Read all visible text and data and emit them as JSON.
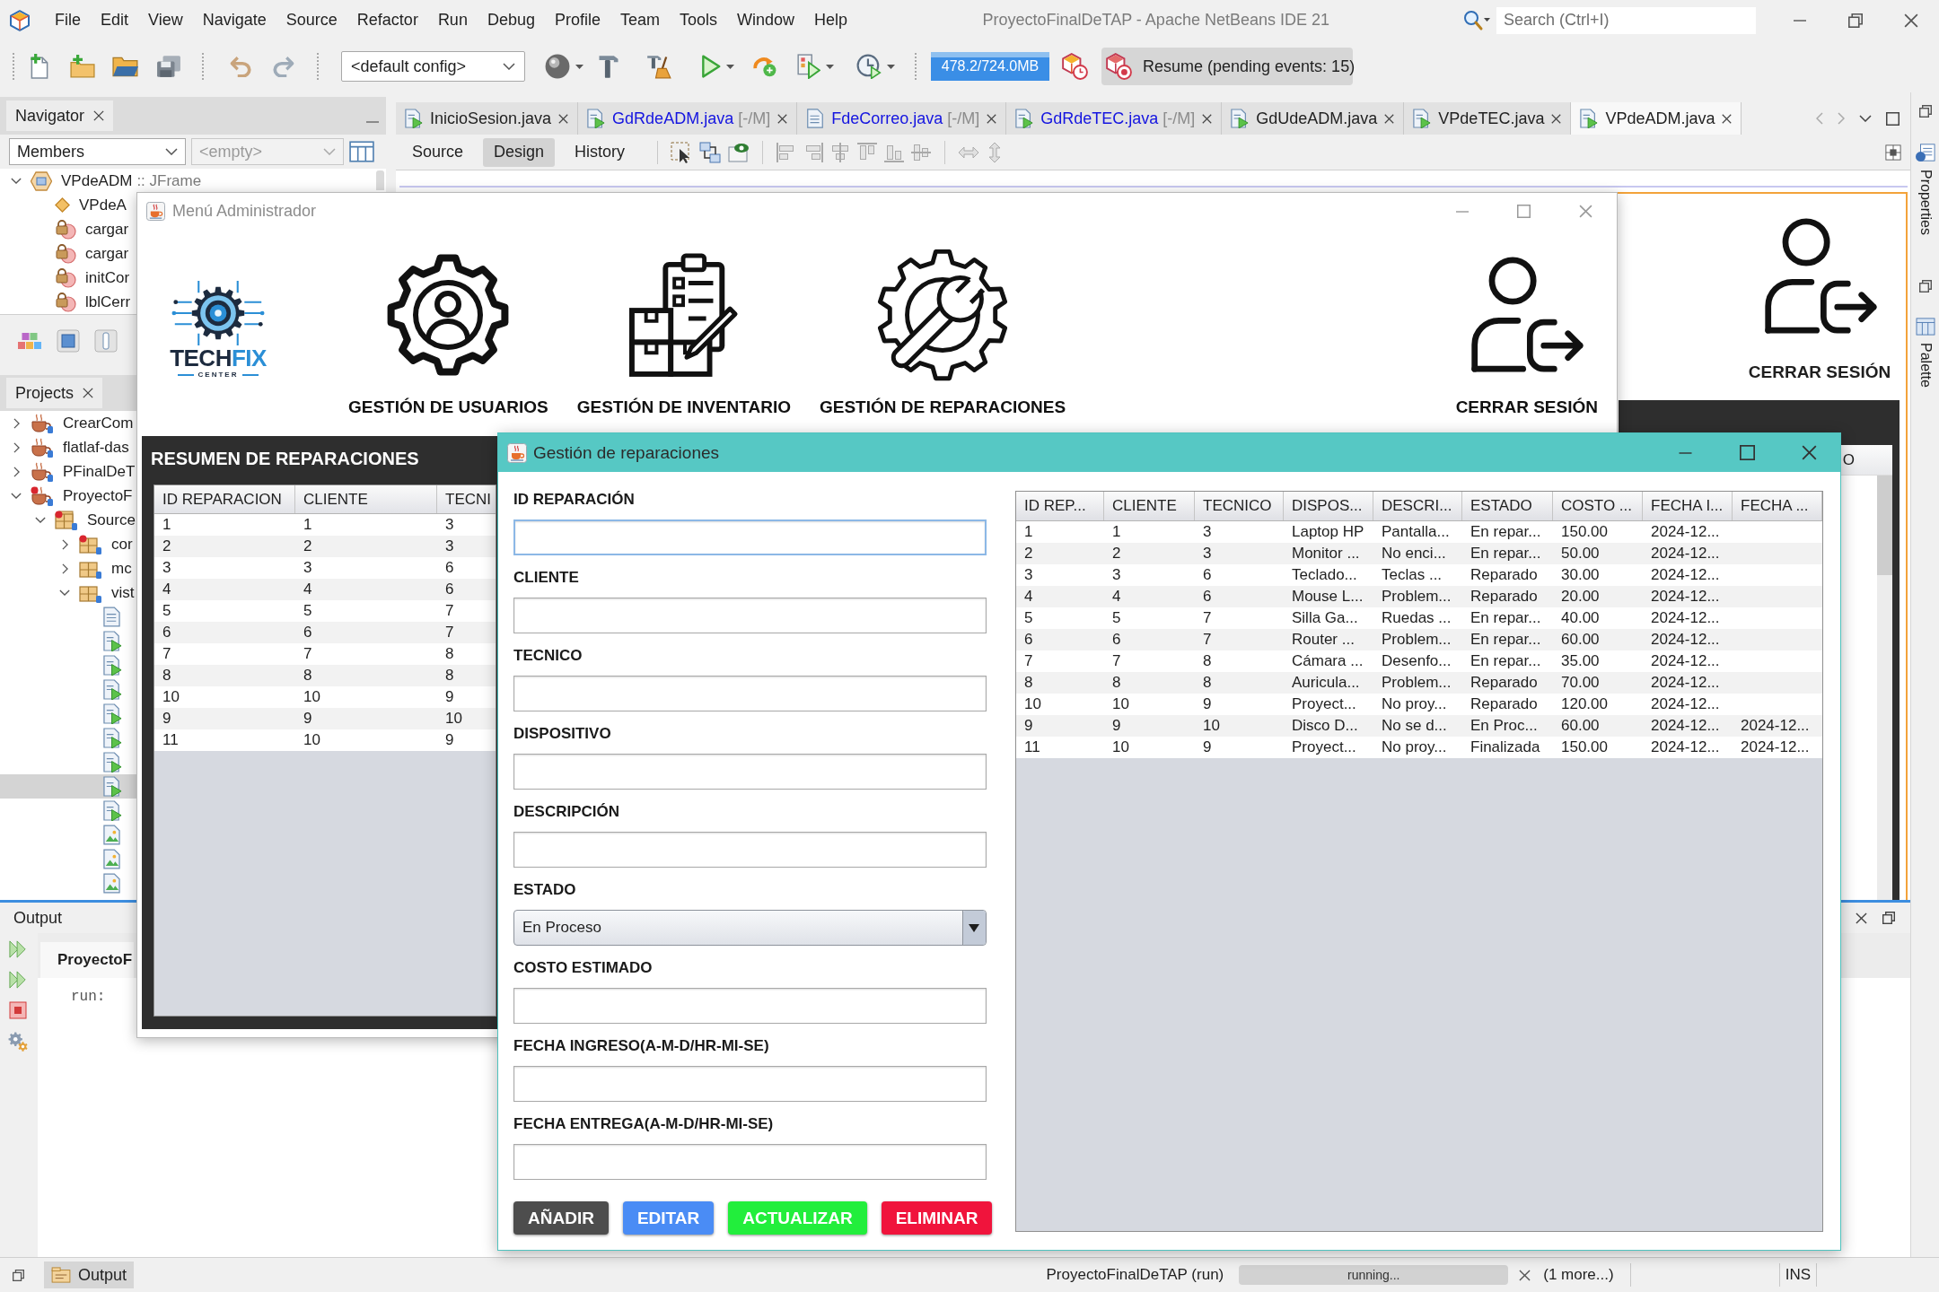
{
  "ide": {
    "title": "ProyectoFinalDeTAP - Apache NetBeans IDE 21",
    "menu": [
      "File",
      "Edit",
      "View",
      "Navigate",
      "Source",
      "Refactor",
      "Run",
      "Debug",
      "Profile",
      "Team",
      "Tools",
      "Window",
      "Help"
    ],
    "search": {
      "placeholder": "Search (Ctrl+I)"
    },
    "toolbar": {
      "config": "<default config>",
      "memory": "478.2/724.0MB",
      "resume": "Resume (pending events: 15)"
    },
    "navigator": {
      "title": "Navigator",
      "filter": "Members",
      "scope": "<empty>",
      "tree": [
        {
          "label": "VPdeADM",
          "detail": ":: JFrame",
          "kind": "frame",
          "expanded": true,
          "children": [
            {
              "label": "VPdeA",
              "kind": "constructor"
            },
            {
              "label": "cargar",
              "kind": "method"
            },
            {
              "label": "cargar",
              "kind": "method"
            },
            {
              "label": "initCor",
              "kind": "method"
            },
            {
              "label": "lblCerr",
              "kind": "method"
            }
          ]
        }
      ]
    },
    "projects": {
      "title": "Projects",
      "tree": [
        {
          "label": "CrearCom",
          "kind": "project",
          "expanded": false,
          "selected": false
        },
        {
          "label": "flatlaf-das",
          "kind": "project",
          "expanded": false,
          "selected": false
        },
        {
          "label": "PFinalDeT",
          "kind": "project",
          "expanded": false,
          "selected": false
        },
        {
          "label": "ProyectoF",
          "kind": "project-error",
          "expanded": true,
          "selected": false,
          "children": [
            {
              "label": "Source",
              "kind": "sources",
              "expanded": true,
              "selected": false,
              "children": [
                {
                  "label": "cor",
                  "kind": "package-error",
                  "expanded": false,
                  "selected": false
                },
                {
                  "label": "mc",
                  "kind": "package",
                  "expanded": false,
                  "selected": false
                },
                {
                  "label": "vist",
                  "kind": "package",
                  "expanded": true,
                  "selected": false,
                  "children": [
                    {
                      "kind": "file",
                      "selected": false
                    },
                    {
                      "kind": "form",
                      "selected": false
                    },
                    {
                      "kind": "form",
                      "selected": false
                    },
                    {
                      "kind": "form",
                      "selected": false
                    },
                    {
                      "kind": "form",
                      "selected": false
                    },
                    {
                      "kind": "form",
                      "selected": false
                    },
                    {
                      "kind": "form",
                      "selected": false
                    },
                    {
                      "kind": "form",
                      "selected": true
                    },
                    {
                      "kind": "form",
                      "selected": false
                    },
                    {
                      "kind": "image",
                      "selected": false
                    },
                    {
                      "kind": "image",
                      "selected": false
                    },
                    {
                      "kind": "image",
                      "selected": false
                    }
                  ]
                }
              ]
            }
          ]
        }
      ]
    },
    "editor_tabs": [
      {
        "label": "InicioSesion.java",
        "kind": "form",
        "modified": false,
        "selected": false
      },
      {
        "label": "GdRdeADM.java",
        "suffix": "[-/M]",
        "kind": "form",
        "modified": true,
        "selected": false
      },
      {
        "label": "FdeCorreo.java",
        "suffix": "[-/M]",
        "kind": "class",
        "modified": true,
        "selected": false
      },
      {
        "label": "GdRdeTEC.java",
        "suffix": "[-/M]",
        "kind": "form",
        "modified": true,
        "selected": false
      },
      {
        "label": "GdUdeADM.java",
        "kind": "form",
        "modified": false,
        "selected": false
      },
      {
        "label": "VPdeTEC.java",
        "kind": "form",
        "modified": false,
        "selected": false
      },
      {
        "label": "VPdeADM.java",
        "kind": "form",
        "modified": false,
        "selected": true
      }
    ],
    "design_views": [
      {
        "label": "Source",
        "selected": false
      },
      {
        "label": "Design",
        "selected": true
      },
      {
        "label": "History",
        "selected": false
      }
    ],
    "design_form": {
      "logout_label": "CERRAR SESIÓN",
      "table_header": "O"
    },
    "side_panels": [
      {
        "label": "Properties",
        "kind": "properties"
      },
      {
        "label": "Palette",
        "kind": "palette"
      }
    ],
    "output": {
      "title": "Output",
      "tab": "ProyectoF",
      "text": "run:"
    },
    "status_bar": {
      "output_button": "Output",
      "task": "ProyectoFinalDeTAP (run)",
      "progress": "running...",
      "more": "(1 more...)",
      "mode": "INS"
    }
  },
  "menu_window": {
    "title": "Menú Administrador",
    "logo": {
      "name_1": "TECH",
      "name_2": "FIX",
      "tagline": "CENTER"
    },
    "nav": [
      {
        "label": "GESTIÓN DE USUARIOS",
        "kind": "users"
      },
      {
        "label": "GESTIÓN DE INVENTARIO",
        "kind": "inventory"
      },
      {
        "label": "GESTIÓN DE REPARACIONES",
        "kind": "repairs"
      },
      {
        "label": "CERRAR SESIÓN",
        "kind": "logout"
      }
    ],
    "summary": {
      "title": "RESUMEN DE REPARACIONES",
      "columns": [
        "ID REPARACION",
        "CLIENTE",
        "TECNI"
      ],
      "rows": [
        [
          "1",
          "1",
          "3"
        ],
        [
          "2",
          "2",
          "3"
        ],
        [
          "3",
          "3",
          "6"
        ],
        [
          "4",
          "4",
          "6"
        ],
        [
          "5",
          "5",
          "7"
        ],
        [
          "6",
          "6",
          "7"
        ],
        [
          "7",
          "7",
          "8"
        ],
        [
          "8",
          "8",
          "8"
        ],
        [
          "10",
          "10",
          "9"
        ],
        [
          "9",
          "9",
          "10"
        ],
        [
          "11",
          "10",
          "9"
        ]
      ]
    }
  },
  "repairs_window": {
    "title": "Gestión de reparaciones",
    "fields": [
      {
        "label": "ID REPARACIÓN",
        "kind": "text",
        "focused": true
      },
      {
        "label": "CLIENTE",
        "kind": "text",
        "focused": false
      },
      {
        "label": "TECNICO",
        "kind": "text",
        "focused": false
      },
      {
        "label": "DISPOSITIVO",
        "kind": "text",
        "focused": false
      },
      {
        "label": "DESCRIPCIÓN",
        "kind": "text",
        "focused": false
      },
      {
        "label": "ESTADO",
        "kind": "select",
        "value": "En Proceso",
        "focused": false
      },
      {
        "label": "COSTO ESTIMADO",
        "kind": "text",
        "focused": false
      },
      {
        "label": "FECHA INGRESO(A-M-D/HR-MI-SE)",
        "kind": "text",
        "focused": false
      },
      {
        "label": "FECHA ENTREGA(A-M-D/HR-MI-SE)",
        "kind": "text",
        "focused": false
      }
    ],
    "buttons": [
      {
        "label": "AÑADIR",
        "color": "#4d4d4d"
      },
      {
        "label": "EDITAR",
        "color": "#4a8cf5"
      },
      {
        "label": "ACTUALIZAR",
        "color": "#22ee3c"
      },
      {
        "label": "ELIMINAR",
        "color": "#f0143c"
      }
    ],
    "table": {
      "columns": [
        "ID REP...",
        "CLIENTE",
        "TECNICO",
        "DISPOS...",
        "DESCRI...",
        "ESTADO",
        "COSTO ...",
        "FECHA I...",
        "FECHA ..."
      ],
      "rows": [
        [
          "1",
          "1",
          "3",
          "Laptop HP",
          "Pantalla...",
          "En repar...",
          "150.00",
          "2024-12..."
        ],
        [
          "2",
          "2",
          "3",
          "Monitor ...",
          "No enci...",
          "En repar...",
          "50.00",
          "2024-12..."
        ],
        [
          "3",
          "3",
          "6",
          "Teclado...",
          "Teclas ...",
          "Reparado",
          "30.00",
          "2024-12..."
        ],
        [
          "4",
          "4",
          "6",
          "Mouse L...",
          "Problem...",
          "Reparado",
          "20.00",
          "2024-12..."
        ],
        [
          "5",
          "5",
          "7",
          "Silla Ga...",
          "Ruedas ...",
          "En repar...",
          "40.00",
          "2024-12..."
        ],
        [
          "6",
          "6",
          "7",
          "Router ...",
          "Problem...",
          "En repar...",
          "60.00",
          "2024-12..."
        ],
        [
          "7",
          "7",
          "8",
          "Cámara ...",
          "Desenfo...",
          "En repar...",
          "35.00",
          "2024-12..."
        ],
        [
          "8",
          "8",
          "8",
          "Auricula...",
          "Problem...",
          "Reparado",
          "70.00",
          "2024-12..."
        ],
        [
          "10",
          "10",
          "9",
          "Proyect...",
          "No proy...",
          "Reparado",
          "120.00",
          "2024-12..."
        ],
        [
          "9",
          "9",
          "10",
          "Disco D...",
          "No se d...",
          "En Proc...",
          "60.00",
          "2024-12...",
          "2024-12..."
        ],
        [
          "11",
          "10",
          "9",
          "Proyect...",
          "No proy...",
          "Finalizada",
          "150.00",
          "2024-12...",
          "2024-12..."
        ]
      ]
    }
  }
}
